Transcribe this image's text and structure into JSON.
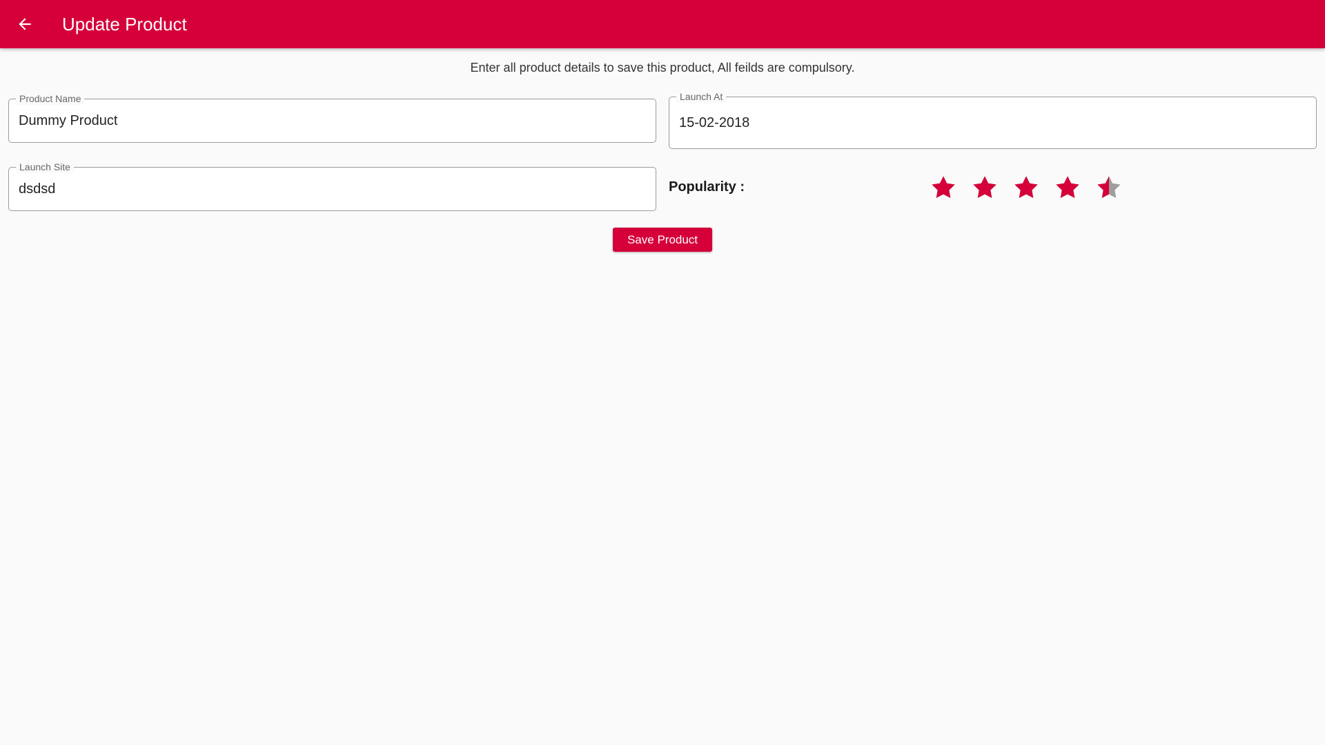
{
  "app_bar": {
    "title": "Update Product",
    "back_icon": "arrow-back-icon",
    "background": "#d5003a"
  },
  "form": {
    "instructions": "Enter all product details to save this product, All feilds are compulsory.",
    "product_name": {
      "label": "Product Name",
      "value": "Dummy Product"
    },
    "launch_at": {
      "label": "Launch At",
      "value": "15-02-2018"
    },
    "launch_site": {
      "label": "Launch Site",
      "value": "dsdsd"
    },
    "popularity": {
      "label": "Popularity :",
      "rating": 4.5,
      "max": 5,
      "icon": "star-icon",
      "filled_color": "#d5003a",
      "empty_color": "#9e9e9e"
    },
    "save_label": "Save Product"
  }
}
